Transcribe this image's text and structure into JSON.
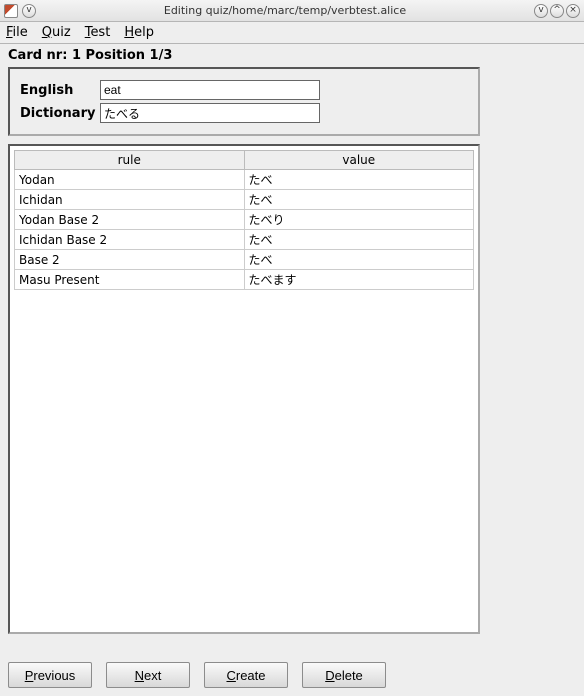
{
  "window": {
    "title": "Editing quiz/home/marc/temp/verbtest.alice",
    "minimize_glyph": "ⅴ",
    "maximize_glyph": "^",
    "close_glyph": "×",
    "dropdown_glyph": "ⅴ"
  },
  "menu": {
    "file": "File",
    "quiz": "Quiz",
    "test": "Test",
    "help": "Help"
  },
  "card": {
    "label": "Card nr: 1 Position 1/3"
  },
  "fields": {
    "english_label": "English",
    "english_value": "eat",
    "dictionary_label": "Dictionary",
    "dictionary_value": "たべる"
  },
  "table": {
    "headers": {
      "rule": "rule",
      "value": "value"
    },
    "rows": [
      {
        "rule": "Yodan",
        "value": "たべ"
      },
      {
        "rule": "Ichidan",
        "value": "たべ"
      },
      {
        "rule": "Yodan Base 2",
        "value": "たべり"
      },
      {
        "rule": "Ichidan Base 2",
        "value": "たべ"
      },
      {
        "rule": "Base 2",
        "value": "たべ"
      },
      {
        "rule": "Masu Present",
        "value": "たべます"
      }
    ]
  },
  "buttons": {
    "previous": "Previous",
    "next": "Next",
    "create": "Create",
    "delete": "Delete"
  }
}
